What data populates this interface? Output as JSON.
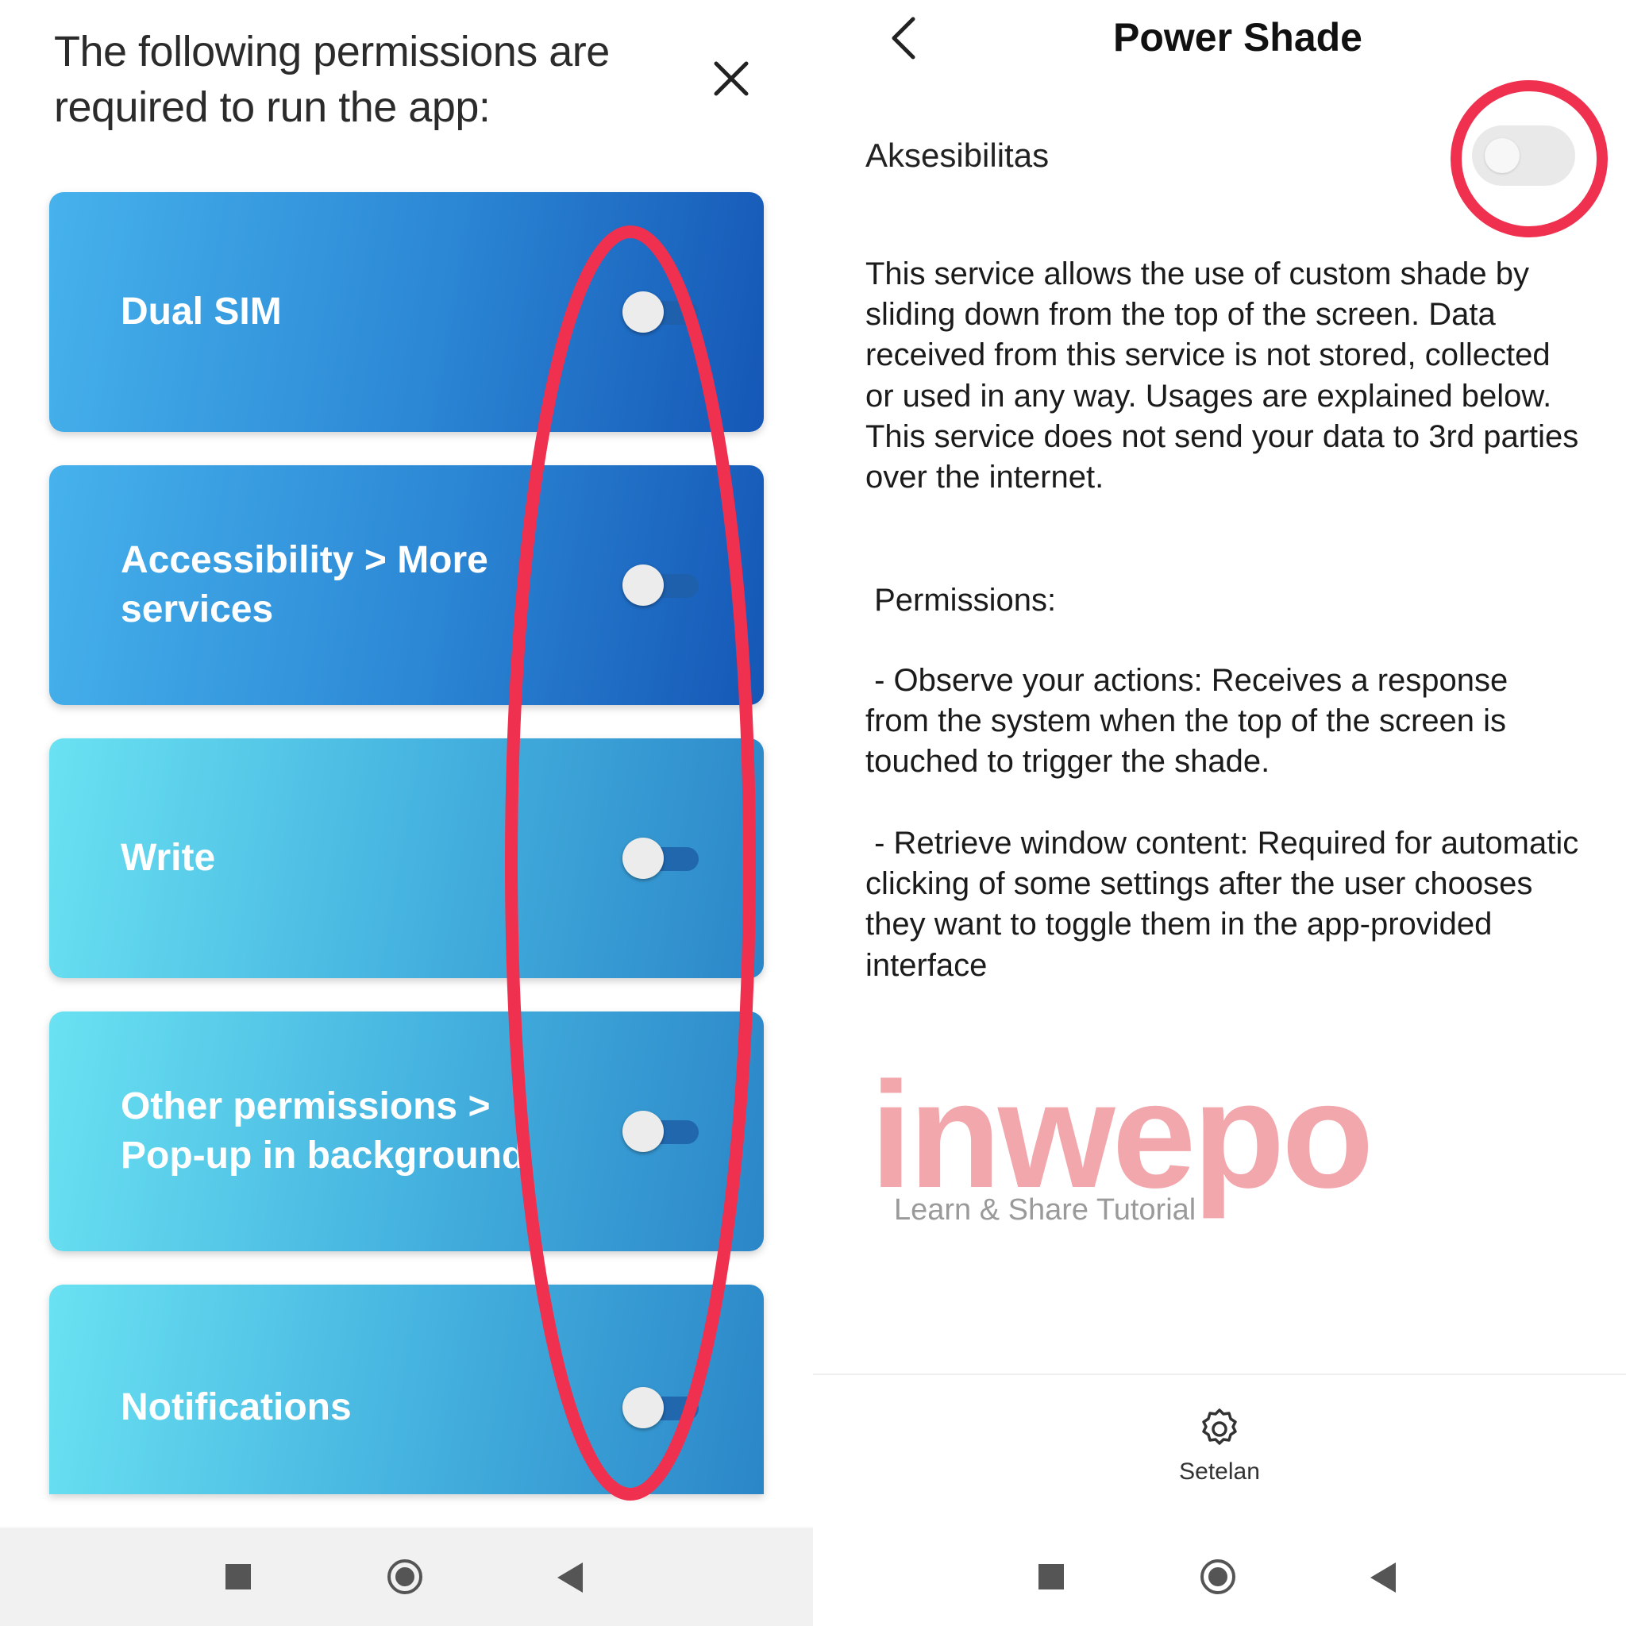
{
  "left_panel": {
    "title": "The following permissions are required to run the app:",
    "close_icon": "close-icon",
    "permissions": [
      {
        "label": "Dual SIM",
        "enabled": false
      },
      {
        "label": "Accessibility > More\nservices",
        "enabled": false
      },
      {
        "label": "Write",
        "enabled": false
      },
      {
        "label": "Other permissions >\nPop-up in background",
        "enabled": false
      },
      {
        "label": "Notifications",
        "enabled": false
      }
    ],
    "highlight_color": "#f0304f"
  },
  "right_panel": {
    "title": "Power Shade",
    "back_icon": "chevron-left-icon",
    "setting_label": "Aksesibilitas",
    "setting_enabled": false,
    "description": "This service allows the use of custom shade by sliding down from the top of the screen. Data received from this service is not stored, collected or used in any way. Usages are explained below. This service does not send your data to 3rd parties over the internet.",
    "permissions_title": " Permissions:",
    "permission_items": [
      " - Observe your actions: Receives a response from the system when the top of the screen is touched to trigger the shade.",
      " - Retrieve window content: Required for automatic clicking of some settings after the user chooses they want to toggle them in the app-provided interface"
    ],
    "bottom_nav_label": "Setelan",
    "bottom_nav_icon": "gear-icon"
  },
  "watermark": {
    "word": "inwepo",
    "tagline": "Learn & Share Tutorial",
    "color": "#f2a7ad"
  },
  "nav_bar": {
    "icons": [
      "recents-square-icon",
      "home-circle-icon",
      "back-triangle-icon"
    ]
  }
}
